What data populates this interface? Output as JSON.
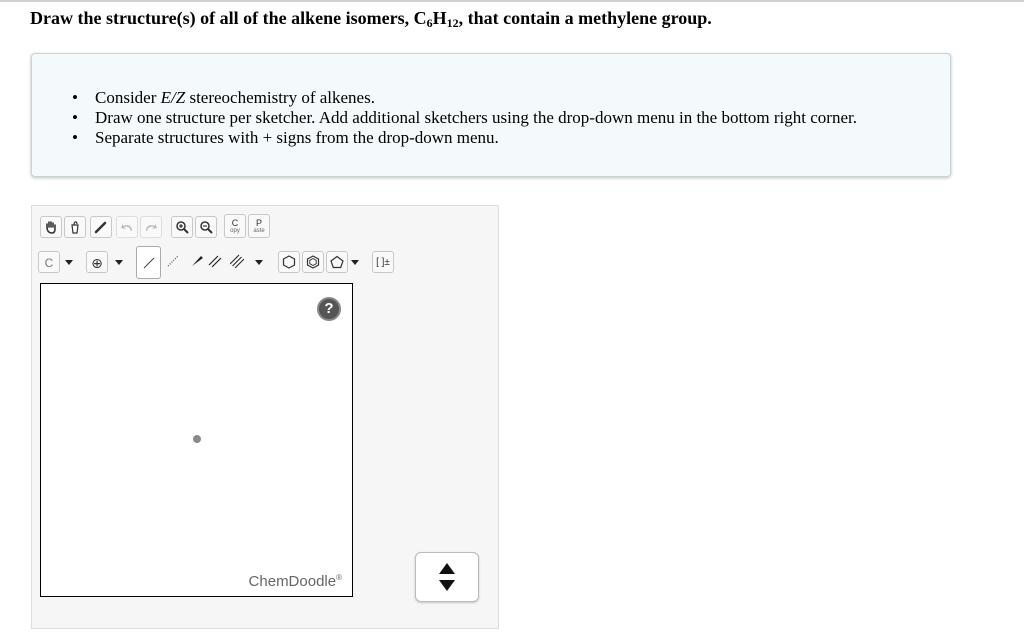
{
  "question": {
    "prefix": "Draw the structure(s) of all of the alkene isomers, C",
    "sub1": "6",
    "h": "H",
    "sub2": "12",
    "suffix": ", that contain a methylene group."
  },
  "instructions": {
    "items": [
      {
        "pre": "Consider ",
        "em": "E/Z",
        "post": " stereochemistry of alkenes."
      },
      {
        "pre": "Draw one structure per sketcher. Add additional sketchers using the drop-down menu in the bottom right corner.",
        "em": "",
        "post": ""
      },
      {
        "pre": "Separate structures with + signs from the drop-down menu.",
        "em": "",
        "post": ""
      }
    ]
  },
  "toolbar": {
    "copy": {
      "big": "C",
      "small": "opy"
    },
    "paste": {
      "big": "P",
      "small": "aste"
    },
    "atom_label": "C",
    "charge_label": "⊕",
    "bracket_label": "[ ]±"
  },
  "canvas": {
    "help_label": "?",
    "brand": "ChemDoodle",
    "brand_mark": "®"
  },
  "colors": {
    "instructions_bg": "#f4fafb",
    "panel_bg": "#f6f6f6",
    "accent_dark": "#222222"
  }
}
